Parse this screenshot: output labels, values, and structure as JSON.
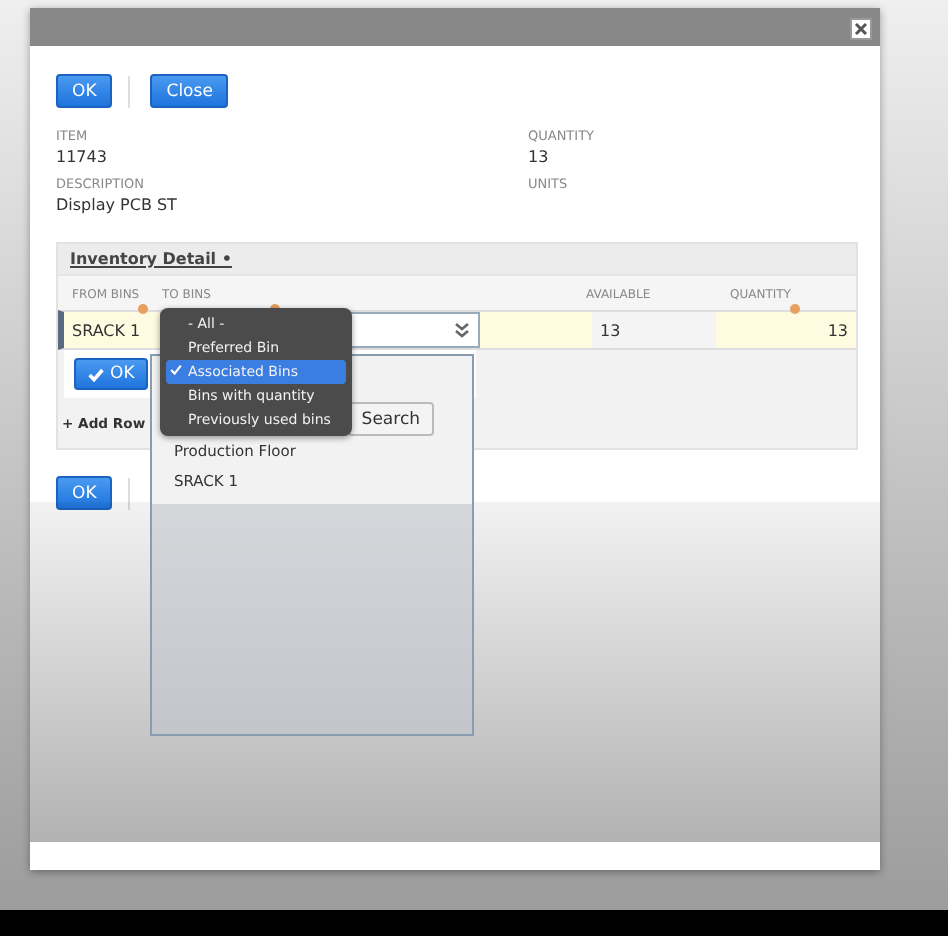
{
  "top_buttons": [
    {
      "label": "OK"
    },
    {
      "label": "Close"
    }
  ],
  "fields": [
    {
      "label": "ITEM",
      "value": "11743"
    },
    {
      "label": "QUANTITY",
      "value": "13"
    },
    {
      "label": "DESCRIPTION",
      "value": "Display PCB ST"
    },
    {
      "label": "UNITS"
    }
  ],
  "inventory_detail": {
    "title": "Inventory Detail •",
    "columns": [
      {
        "label": "FROM BINS",
        "required": true
      },
      {
        "label": "TO BINS",
        "required": true
      },
      {
        "label": "AVAILABLE",
        "required": false
      },
      {
        "label": "QUANTITY",
        "required": true
      }
    ],
    "row": {
      "from_bins": "SRACK 1",
      "available": "13",
      "quantity": "13"
    },
    "ok_button": "OK",
    "add_row": "+ Add Row"
  },
  "bottom_buttons": [
    {
      "label": "OK"
    }
  ],
  "filter_menu": [
    {
      "label": "- All -",
      "selected": false
    },
    {
      "label": "Preferred Bin",
      "selected": false
    },
    {
      "label": "Associated Bins",
      "selected": true
    },
    {
      "label": "Bins with quantity",
      "selected": false
    },
    {
      "label": "Previously used bins",
      "selected": false
    }
  ],
  "bin_panel": {
    "search_button": "Search",
    "bins": [
      "Production Floor",
      "SRACK 1"
    ]
  }
}
